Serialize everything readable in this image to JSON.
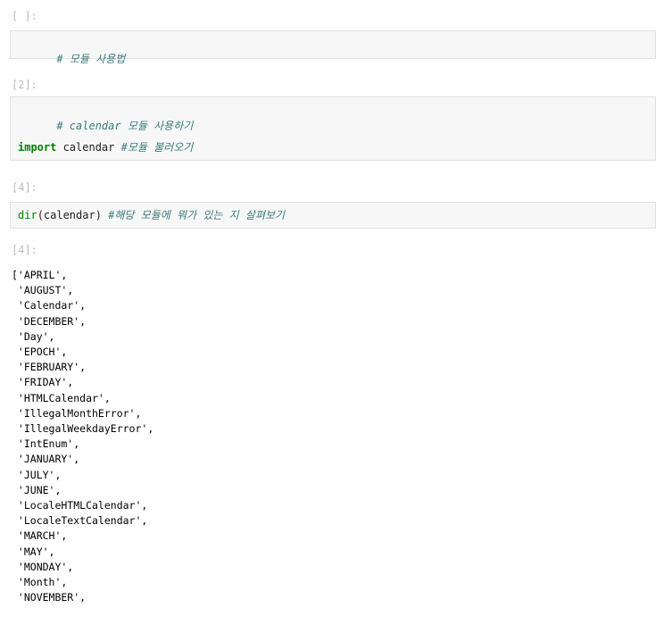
{
  "cells": [
    {
      "prompt": "[ ]:",
      "comment": "# 모듈 사용법"
    },
    {
      "prompt": "[2]:",
      "comment": "# calendar 모듈 사용하기",
      "keyword": "import",
      "code": " calendar ",
      "trailing_comment": "#모듈 불러오기"
    },
    {
      "prompt": "[4]:",
      "builtin": "dir",
      "code": "(calendar) ",
      "trailing_comment": "#해당 모듈에 뭐가 있는 지 살펴보기"
    }
  ],
  "output": {
    "prompt": "[4]:",
    "lines": [
      "['APRIL',",
      " 'AUGUST',",
      " 'Calendar',",
      " 'DECEMBER',",
      " 'Day',",
      " 'EPOCH',",
      " 'FEBRUARY',",
      " 'FRIDAY',",
      " 'HTMLCalendar',",
      " 'IllegalMonthError',",
      " 'IllegalWeekdayError',",
      " 'IntEnum',",
      " 'JANUARY',",
      " 'JULY',",
      " 'JUNE',",
      " 'LocaleHTMLCalendar',",
      " 'LocaleTextCalendar',",
      " 'MARCH',",
      " 'MAY',",
      " 'MONDAY',",
      " 'Month',",
      " 'NOVEMBER',"
    ]
  }
}
